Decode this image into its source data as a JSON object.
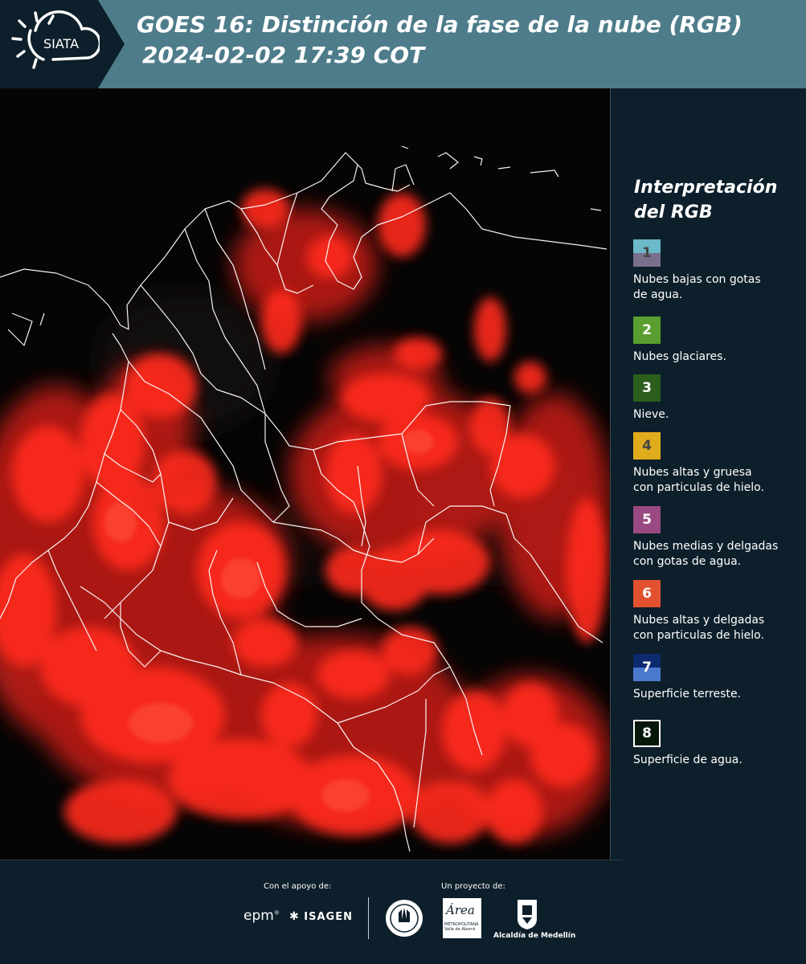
{
  "header": {
    "logo_text": "SIATA",
    "title_line1": "GOES 16: Distinción de la fase de la nube (RGB)",
    "title_line2": "2024-02-02 17:39 COT"
  },
  "legend": {
    "title_line1": "Interpretación",
    "title_line2": "del RGB",
    "items": [
      {
        "num": "1",
        "desc_line1": "Nubes bajas con gotas",
        "desc_line2": "de agua.",
        "color_top": "#6ab8c8",
        "color_bottom": "#7a6f8c",
        "num_color": "#444444"
      },
      {
        "num": "2",
        "desc_line1": "Nubes glaciares.",
        "desc_line2": "",
        "color_top": "#5a9e2f",
        "color_bottom": "#5a9e2f",
        "num_color": "#ffffff"
      },
      {
        "num": "3",
        "desc_line1": "Nieve.",
        "desc_line2": "",
        "color_top": "#2c5e1e",
        "color_bottom": "#2c5e1e",
        "num_color": "#ffffff"
      },
      {
        "num": "4",
        "desc_line1": "Nubes altas y gruesa",
        "desc_line2": "con particulas de hielo.",
        "color_top": "#e0ac1c",
        "color_bottom": "#e0ac1c",
        "num_color": "#444444"
      },
      {
        "num": "5",
        "desc_line1": "Nubes medias y delgadas",
        "desc_line2": "con gotas de agua.",
        "color_top": "#9a4a82",
        "color_bottom": "#9a4a82",
        "num_color": "#ffffff"
      },
      {
        "num": "6",
        "desc_line1": "Nubes altas y delgadas",
        "desc_line2": "con particulas de hielo.",
        "color_top": "#e25230",
        "color_bottom": "#e25230",
        "num_color": "#ffffff"
      },
      {
        "num": "7",
        "desc_line1": "Superficie terreste.",
        "desc_line2": "",
        "color_top": "#0e2a6e",
        "color_bottom": "#4a78cc",
        "num_color": "#ffffff"
      },
      {
        "num": "8",
        "desc_line1": "Superficie de agua.",
        "desc_line2": "",
        "color_top": "#07170a",
        "color_bottom": "#07170a",
        "num_color": "#ffffff"
      }
    ]
  },
  "footer": {
    "support_label": "Con el apoyo de:",
    "project_label": "Un proyecto de:",
    "sponsors": [
      "epm",
      "ISAGEN"
    ],
    "partners": [
      "METROPOLITANA Valle de Aburrá",
      "Alcaldía de Medellín"
    ],
    "area_logo_text": "Área"
  },
  "colors": {
    "header_bg": "#4e7c8a",
    "panel_bg": "#0d1f2a",
    "cloud_red": "#ff2a1a"
  }
}
